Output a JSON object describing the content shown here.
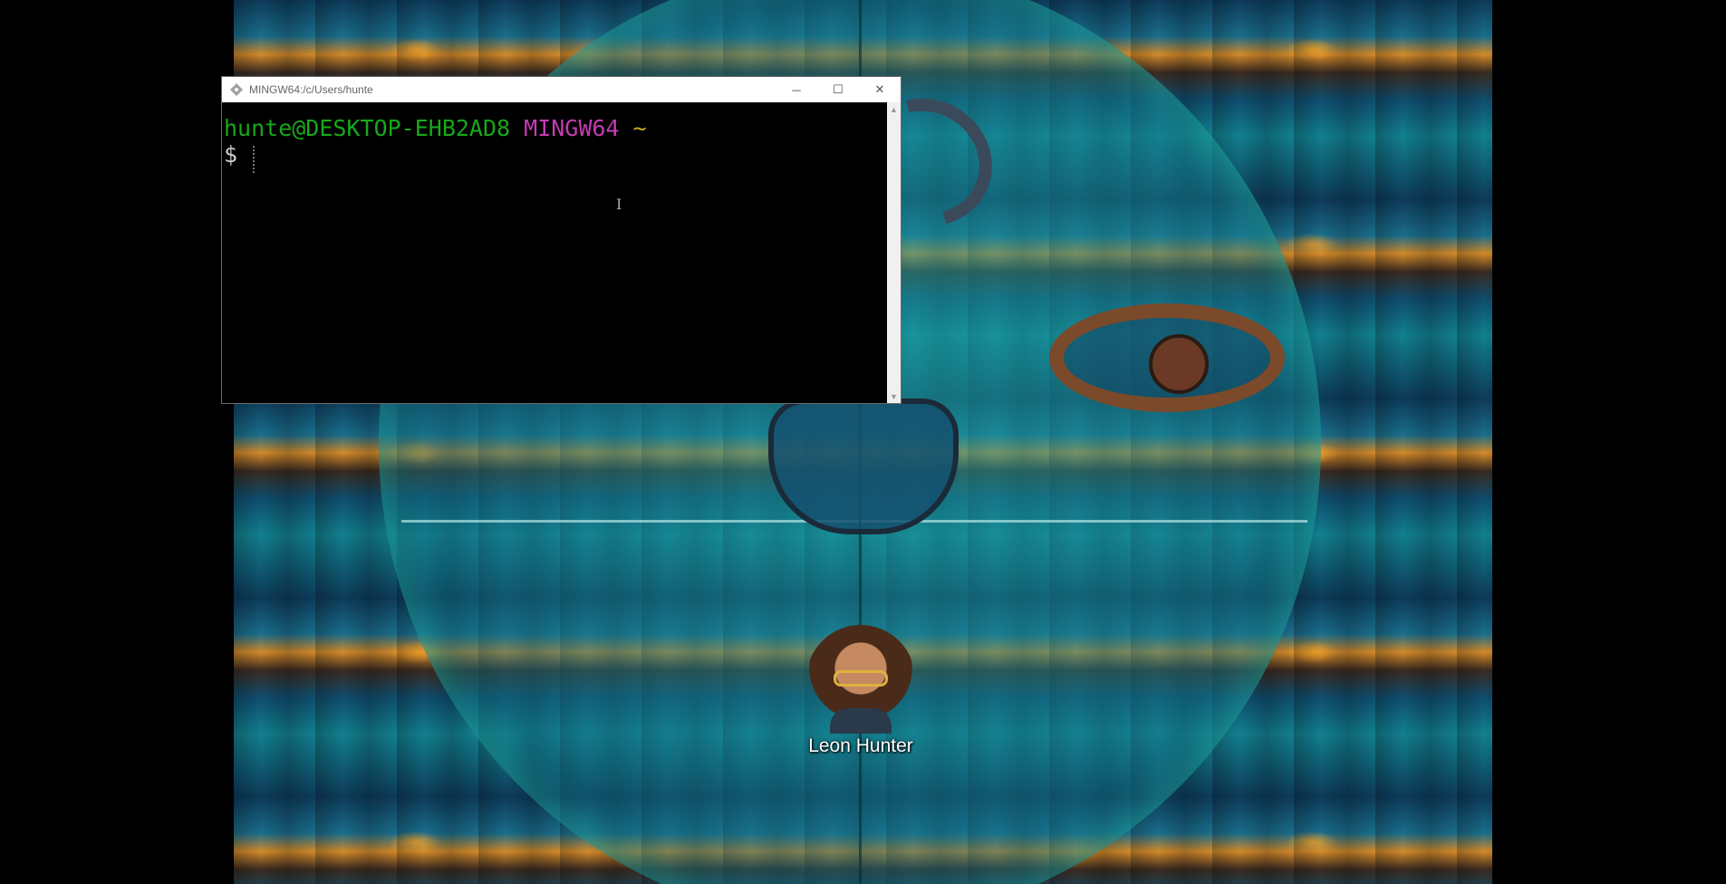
{
  "window": {
    "title": "MINGW64:/c/Users/hunte",
    "controls": {
      "minimize": "─",
      "maximize": "☐",
      "close": "✕"
    }
  },
  "terminal": {
    "user_host": "hunte@DESKTOP-EHB2AD8",
    "env": "MINGW64",
    "cwd": "~",
    "prompt": "$",
    "colors": {
      "user_host": "#17a81a",
      "env": "#c53bb4",
      "cwd": "#c8a923"
    }
  },
  "desktop": {
    "icons": [
      {
        "label": "Leon Hunter",
        "icon": "user-avatar-icon"
      }
    ]
  },
  "scrollbar": {
    "up": "▲",
    "down": "▼"
  }
}
